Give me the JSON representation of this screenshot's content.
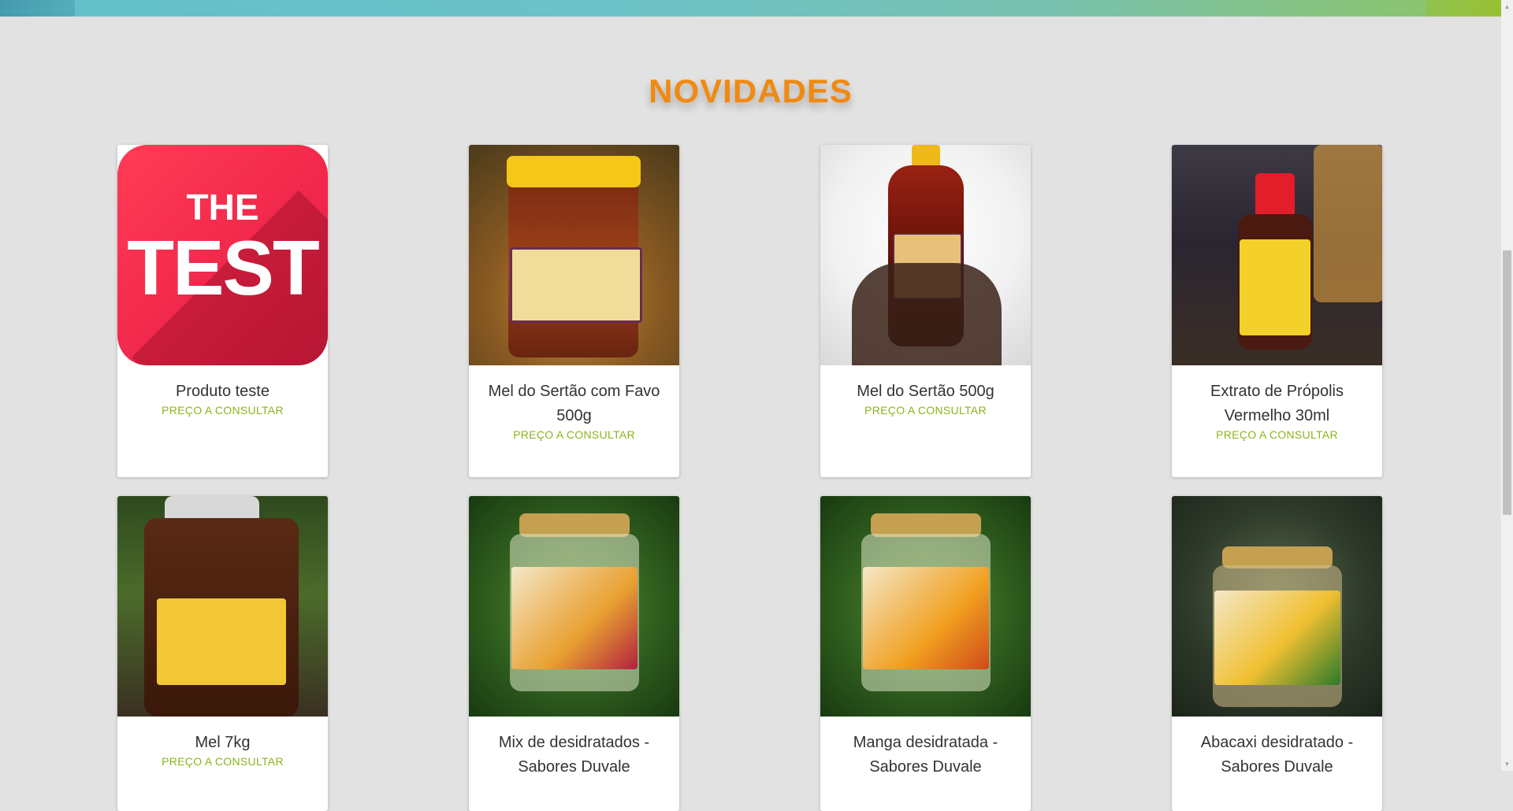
{
  "section": {
    "title": "NOVIDADES"
  },
  "products": [
    {
      "name": "Produto teste",
      "price": "PREÇO A CONSULTAR",
      "image_text_1": "THE",
      "image_text_2": "TEST"
    },
    {
      "name": "Mel do Sertão com Favo 500g",
      "price": "PREÇO A CONSULTAR"
    },
    {
      "name": "Mel do Sertão 500g",
      "price": "PREÇO A CONSULTAR"
    },
    {
      "name": "Extrato de Própolis Vermelho 30ml",
      "price": "PREÇO A CONSULTAR"
    },
    {
      "name": "Mel 7kg",
      "price": "PREÇO A CONSULTAR"
    },
    {
      "name": "Mix de desidratados - Sabores Duvale",
      "price": ""
    },
    {
      "name": "Manga desidratada - Sabores Duvale",
      "price": ""
    },
    {
      "name": "Abacaxi desidratado - Sabores Duvale",
      "price": ""
    }
  ],
  "colors": {
    "title": "#f08a12",
    "price": "#8ab51a",
    "background": "#e2e2e2"
  }
}
